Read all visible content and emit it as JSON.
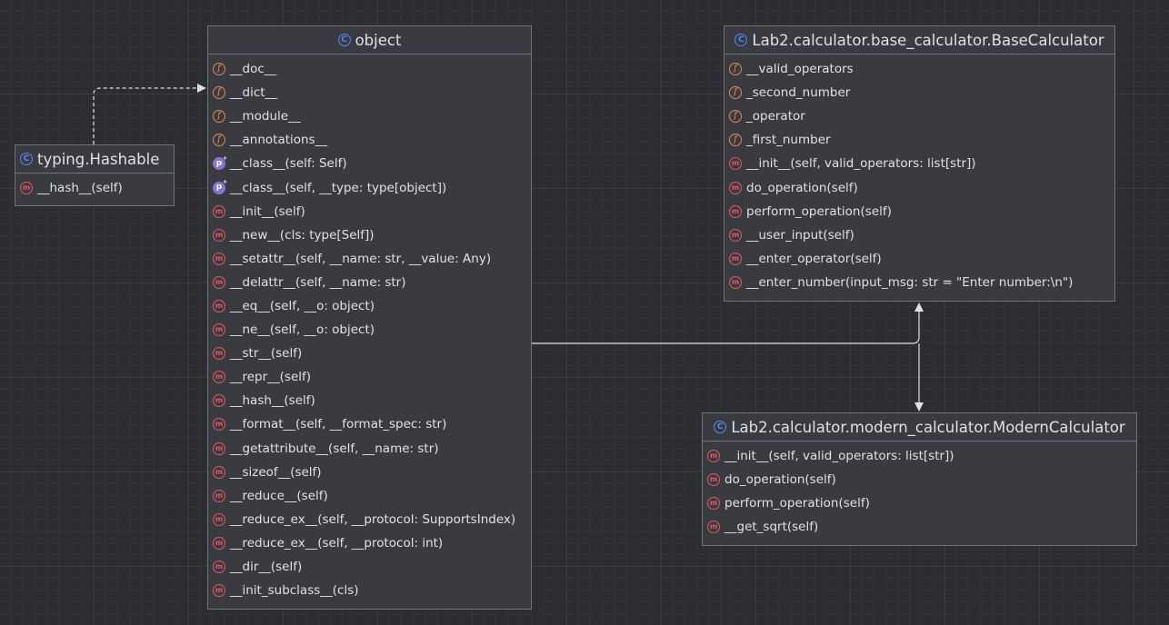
{
  "icon_names": {
    "class": "class-icon",
    "field": "field-icon",
    "method": "method-icon",
    "property": "property-icon"
  },
  "icon_glyphs": {
    "class": "C",
    "field": "f",
    "method": "m",
    "property": "p"
  },
  "colors": {
    "background": "#2b2d30",
    "node_fill": "#393b40",
    "node_border": "#6f737a",
    "class_icon": "#548af7",
    "field_icon": "#e08855",
    "method_icon": "#e55765",
    "property_icon": "#8c72cf",
    "edge": "#dfe1e5"
  },
  "nodes": [
    {
      "id": "object",
      "title": "object",
      "members": [
        {
          "kind": "field",
          "text": "__doc__"
        },
        {
          "kind": "field",
          "text": "__dict__"
        },
        {
          "kind": "field",
          "text": "__module__"
        },
        {
          "kind": "field",
          "text": "__annotations__"
        },
        {
          "kind": "property",
          "text": "__class__(self: Self)"
        },
        {
          "kind": "property",
          "text": "__class__(self, __type: type[object])"
        },
        {
          "kind": "method",
          "text": "__init__(self)"
        },
        {
          "kind": "method",
          "text": "__new__(cls: type[Self])"
        },
        {
          "kind": "method",
          "text": "__setattr__(self, __name: str, __value: Any)"
        },
        {
          "kind": "method",
          "text": "__delattr__(self, __name: str)"
        },
        {
          "kind": "method",
          "text": "__eq__(self, __o: object)"
        },
        {
          "kind": "method",
          "text": "__ne__(self, __o: object)"
        },
        {
          "kind": "method",
          "text": "__str__(self)"
        },
        {
          "kind": "method",
          "text": "__repr__(self)"
        },
        {
          "kind": "method",
          "text": "__hash__(self)"
        },
        {
          "kind": "method",
          "text": "__format__(self, __format_spec: str)"
        },
        {
          "kind": "method",
          "text": "__getattribute__(self, __name: str)"
        },
        {
          "kind": "method",
          "text": "__sizeof__(self)"
        },
        {
          "kind": "method",
          "text": "__reduce__(self)"
        },
        {
          "kind": "method",
          "text": "__reduce_ex__(self, __protocol: SupportsIndex)"
        },
        {
          "kind": "method",
          "text": "__reduce_ex__(self, __protocol: int)"
        },
        {
          "kind": "method",
          "text": "__dir__(self)"
        },
        {
          "kind": "method",
          "text": "__init_subclass__(cls)"
        }
      ]
    },
    {
      "id": "hashable",
      "title": "typing.Hashable",
      "members": [
        {
          "kind": "method",
          "text": "__hash__(self)"
        }
      ]
    },
    {
      "id": "base",
      "title": "Lab2.calculator.base_calculator.BaseCalculator",
      "members": [
        {
          "kind": "field",
          "text": "__valid_operators"
        },
        {
          "kind": "field",
          "text": "_second_number"
        },
        {
          "kind": "field",
          "text": "_operator"
        },
        {
          "kind": "field",
          "text": "_first_number"
        },
        {
          "kind": "method",
          "text": "__init__(self, valid_operators: list[str])"
        },
        {
          "kind": "method",
          "text": "do_operation(self)"
        },
        {
          "kind": "method",
          "text": "perform_operation(self)"
        },
        {
          "kind": "method",
          "text": "__user_input(self)"
        },
        {
          "kind": "method",
          "text": "__enter_operator(self)"
        },
        {
          "kind": "method",
          "text": "__enter_number(input_msg: str = \"Enter number:\\n\")"
        }
      ]
    },
    {
      "id": "modern",
      "title": "Lab2.calculator.modern_calculator.ModernCalculator",
      "members": [
        {
          "kind": "method",
          "text": "__init__(self, valid_operators: list[str])"
        },
        {
          "kind": "method",
          "text": "do_operation(self)"
        },
        {
          "kind": "method",
          "text": "perform_operation(self)"
        },
        {
          "kind": "method",
          "text": "__get_sqrt(self)"
        }
      ]
    }
  ],
  "edges": [
    {
      "from": "hashable",
      "to": "object",
      "style": "dashed"
    },
    {
      "from": "base",
      "to": "object",
      "style": "solid"
    },
    {
      "from": "modern",
      "to": "base",
      "style": "solid"
    }
  ]
}
